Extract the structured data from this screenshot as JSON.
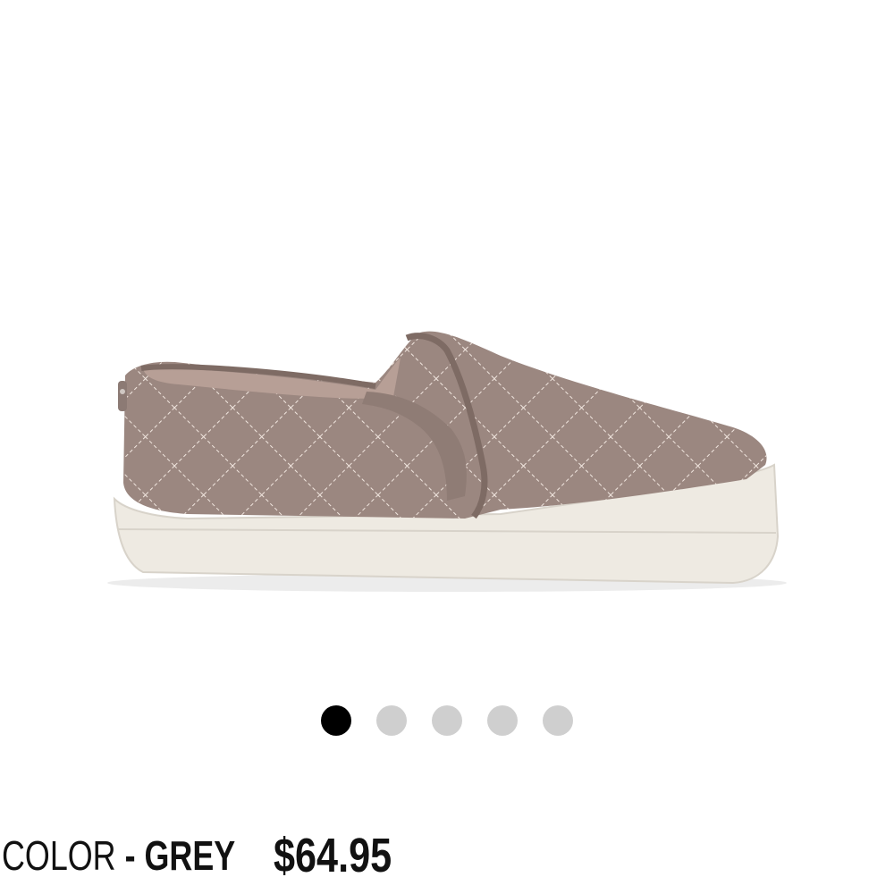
{
  "product": {
    "image_alt": "Grey quilted slip-on sneaker",
    "colors": {
      "upper": "#9b8780",
      "upper_dark": "#7e6b64",
      "stitch": "#f1e6df",
      "sole": "#eeeae2",
      "sole_shadow": "#d8d3ca",
      "lining": "#b79f96"
    }
  },
  "carousel": {
    "dots": [
      {
        "name": "carousel-dot-1",
        "active": true
      },
      {
        "name": "carousel-dot-2",
        "active": false
      },
      {
        "name": "carousel-dot-3",
        "active": false
      },
      {
        "name": "carousel-dot-4",
        "active": false
      },
      {
        "name": "carousel-dot-5",
        "active": false
      }
    ],
    "active_color": "#000000",
    "inactive_color": "#cfcfcf"
  },
  "info": {
    "color_label": "COLOR",
    "separator": " - ",
    "color_value": "GREY",
    "price": "$64.95"
  }
}
